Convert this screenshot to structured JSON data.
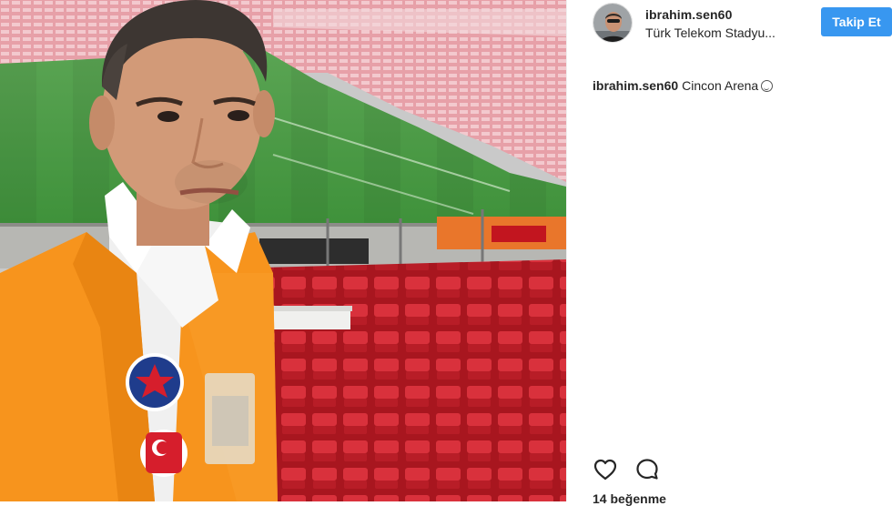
{
  "post": {
    "username": "ibrahim.sen60",
    "location": "Türk Telekom Stadyu...",
    "follow_label": "Takip Et",
    "caption_user": "ibrahim.sen60",
    "caption_text": "Cincon Arena",
    "caption_emoji": "smiley-emoji",
    "likes_text": "14 beğenme"
  },
  "icons": {
    "like": "heart-icon",
    "comment": "comment-icon"
  },
  "colors": {
    "follow_button": "#3897f0",
    "text": "#262626",
    "vest": "#f7941d",
    "seats": "#c8202b",
    "pitch": "#3f9a3c"
  }
}
